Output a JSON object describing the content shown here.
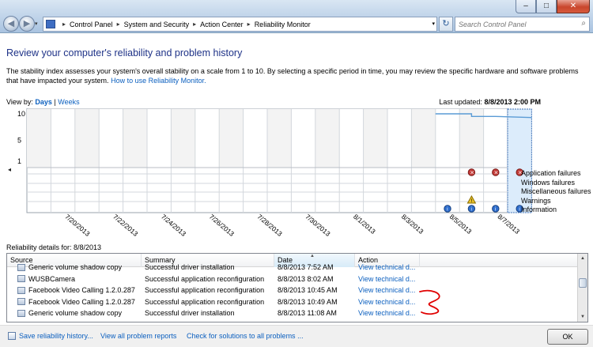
{
  "window": {
    "minimize": "–",
    "maximize": "□",
    "close": "✕"
  },
  "nav": {
    "back_glyph": "◀",
    "forward_glyph": "▶",
    "dropdown_glyph": "▾",
    "refresh_glyph": "↻"
  },
  "breadcrumb": [
    "Control Panel",
    "System and Security",
    "Action Center",
    "Reliability Monitor"
  ],
  "search": {
    "placeholder": "Search Control Panel",
    "icon": "magnifier-icon"
  },
  "page": {
    "title": "Review your computer's reliability and problem history",
    "description": "The stability index assesses your system's overall stability on a scale from 1 to 10. By selecting a specific period in time, you may review the specific hardware and software problems that have impacted your system.",
    "help_link": "How to use Reliability Monitor.",
    "view_by_label": "View by:",
    "view_days": "Days",
    "view_weeks": "Weeks",
    "last_updated_label": "Last updated:",
    "last_updated_value": "8/8/2013 2:00 PM"
  },
  "chart_data": {
    "type": "line",
    "y_ticks": [
      "10",
      "5",
      "1"
    ],
    "ylim": [
      1,
      10
    ],
    "x_labels": [
      "7/20/2013",
      "7/22/2013",
      "7/24/2013",
      "7/26/2013",
      "7/28/2013",
      "7/30/2013",
      "8/1/2013",
      "8/3/2013",
      "8/5/2013",
      "8/7/2013"
    ],
    "row_labels": [
      "Application failures",
      "Windows failures",
      "Miscellaneous failures",
      "Warnings",
      "Information"
    ],
    "stability_index": [
      {
        "date": "8/5/2013",
        "value": 10
      },
      {
        "date": "8/6/2013",
        "value": 10
      },
      {
        "date": "8/6/2013",
        "value": 9.5
      },
      {
        "date": "8/7/2013",
        "value": 9.5
      },
      {
        "date": "8/8/2013",
        "value": 9.3
      }
    ],
    "events": [
      {
        "date": "8/6/2013",
        "row": "Application failures",
        "icon": "error-icon"
      },
      {
        "date": "8/7/2013",
        "row": "Application failures",
        "icon": "error-icon"
      },
      {
        "date": "8/8/2013",
        "row": "Application failures",
        "icon": "error-icon"
      },
      {
        "date": "8/6/2013",
        "row": "Warnings",
        "icon": "warning-icon"
      },
      {
        "date": "8/5/2013",
        "row": "Information",
        "icon": "info-icon"
      },
      {
        "date": "8/6/2013",
        "row": "Information",
        "icon": "info-icon"
      },
      {
        "date": "8/7/2013",
        "row": "Information",
        "icon": "info-icon"
      },
      {
        "date": "8/8/2013",
        "row": "Information",
        "icon": "info-icon"
      }
    ],
    "selected_date": "8/8/2013",
    "grid": true,
    "colors": {
      "error": "#c43c39",
      "warning": "#e8c12a",
      "info": "#2f6fcf",
      "line": "#5a9bd5",
      "selected": "#dcecfb"
    }
  },
  "details": {
    "title": "Reliability details for: 8/8/2013",
    "columns": [
      "Source",
      "Summary",
      "Date",
      "Action"
    ],
    "rows": [
      {
        "source": "Generic volume shadow copy",
        "summary": "Successful driver installation",
        "date": "8/8/2013 7:52 AM",
        "action": "View technical d..."
      },
      {
        "source": "WUSBCamera",
        "summary": "Successful application reconfiguration",
        "date": "8/8/2013 8:02 AM",
        "action": "View technical d..."
      },
      {
        "source": "Facebook Video Calling 1.2.0.287",
        "summary": "Successful application reconfiguration",
        "date": "8/8/2013 10:45 AM",
        "action": "View technical d..."
      },
      {
        "source": "Facebook Video Calling 1.2.0.287",
        "summary": "Successful application reconfiguration",
        "date": "8/8/2013 10:49 AM",
        "action": "View technical d..."
      },
      {
        "source": "Generic volume shadow copy",
        "summary": "Successful driver installation",
        "date": "8/8/2013 11:08 AM",
        "action": "View technical d..."
      }
    ]
  },
  "footer": {
    "save_history": "Save reliability history...",
    "view_all_reports": "View all problem reports",
    "check_solutions": "Check for solutions to all problems ...",
    "ok": "OK"
  },
  "colors": {
    "heading": "#1e3287",
    "link": "#0b5fbf",
    "annotation": "#e00000"
  }
}
